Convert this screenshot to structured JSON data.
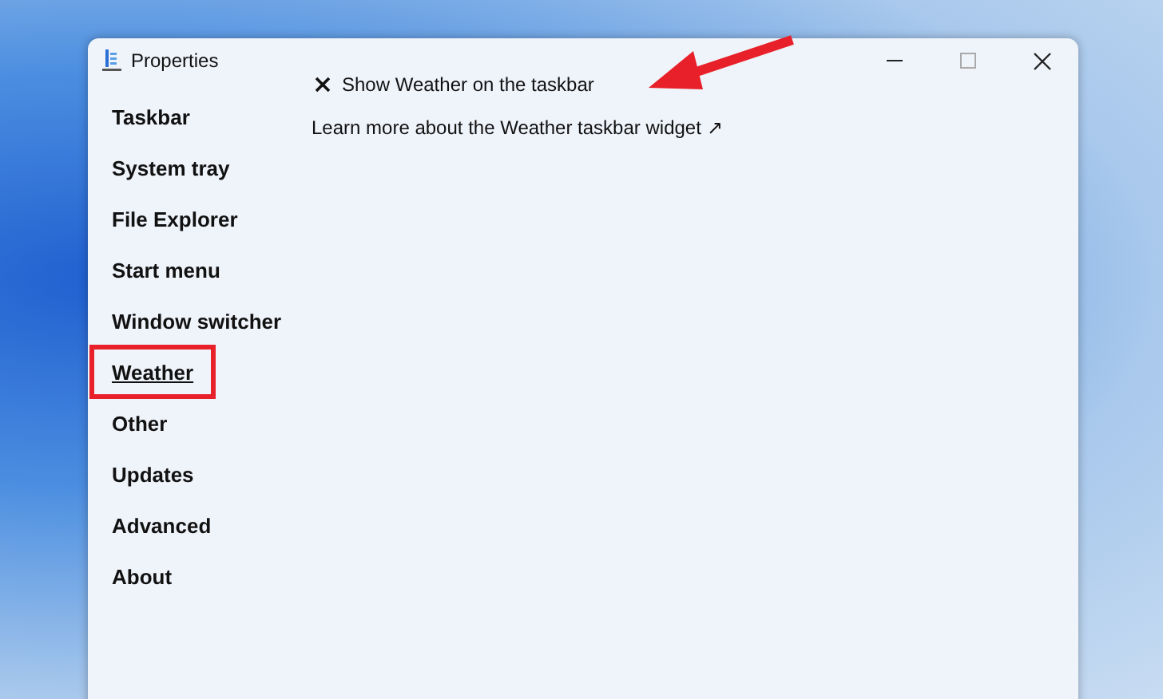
{
  "window": {
    "title": "Properties"
  },
  "sidebar": {
    "items": [
      {
        "label": "Taskbar",
        "selected": false
      },
      {
        "label": "System tray",
        "selected": false
      },
      {
        "label": "File Explorer",
        "selected": false
      },
      {
        "label": "Start menu",
        "selected": false
      },
      {
        "label": "Window switcher",
        "selected": false
      },
      {
        "label": "Weather",
        "selected": true
      },
      {
        "label": "Other",
        "selected": false
      },
      {
        "label": "Updates",
        "selected": false
      },
      {
        "label": "Advanced",
        "selected": false
      },
      {
        "label": "About",
        "selected": false
      }
    ]
  },
  "settings": [
    {
      "kind": "toggle",
      "label": "Show Weather on the taskbar",
      "checked": false
    },
    {
      "kind": "link",
      "label": "Learn more about the Weather taskbar widget ↗"
    }
  ]
}
